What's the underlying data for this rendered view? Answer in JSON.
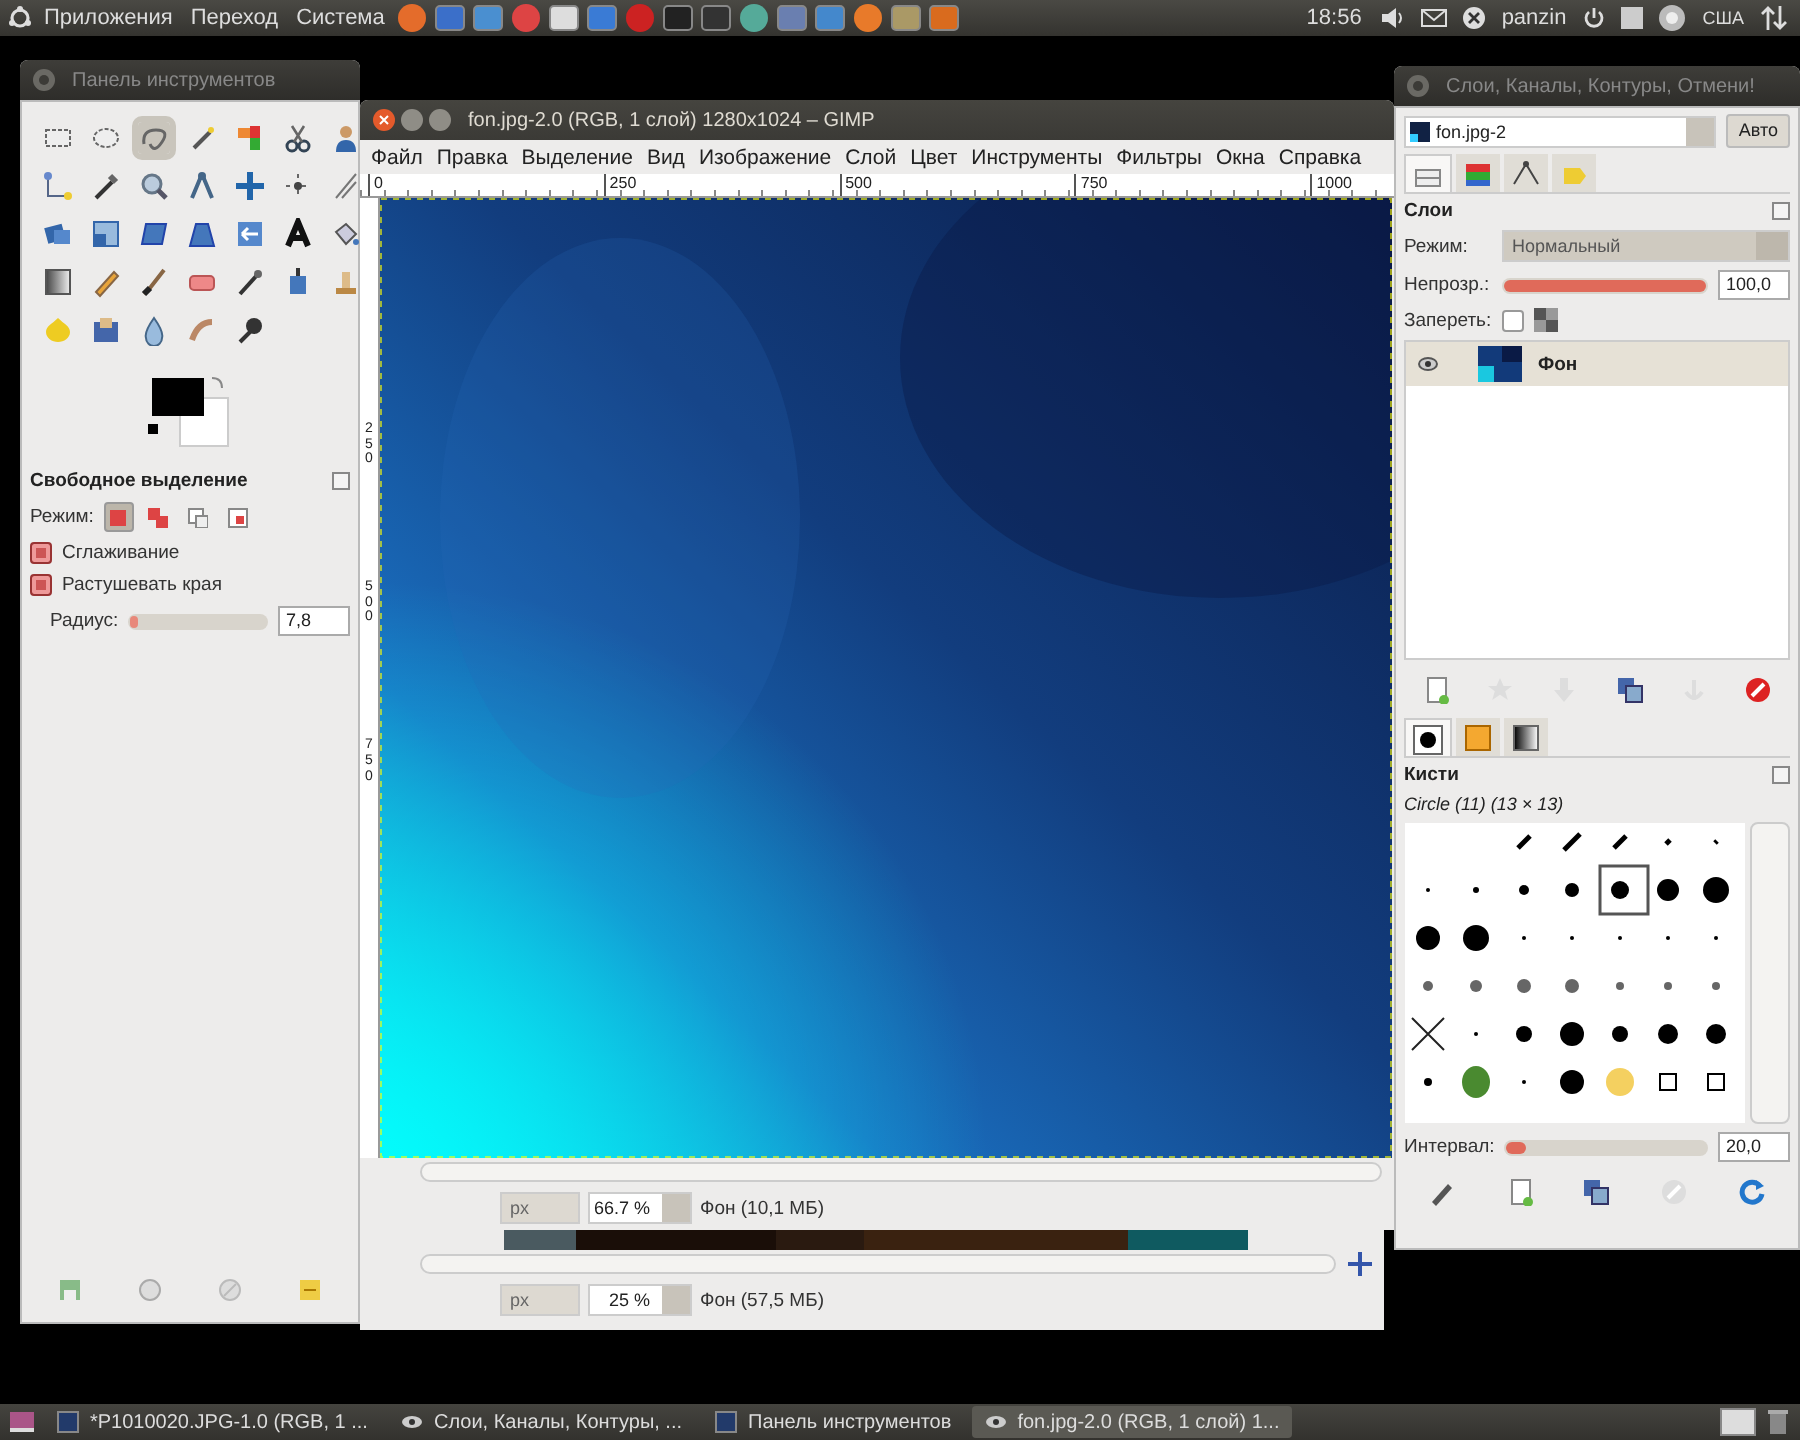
{
  "top_panel": {
    "menus": [
      "Приложения",
      "Переход",
      "Система"
    ],
    "time": "18:56",
    "user": "panzin",
    "keyboard": "США"
  },
  "toolbox": {
    "title": "Панель инструментов",
    "tools": [
      {
        "selected": false
      },
      {
        "selected": false
      },
      {
        "selected": true
      },
      {
        "selected": false
      },
      {
        "selected": false
      },
      {
        "selected": false
      },
      {
        "selected": false
      },
      {
        "selected": false
      },
      {
        "selected": false
      },
      {
        "selected": false
      },
      {
        "selected": false
      },
      {
        "selected": false
      },
      {
        "selected": false
      },
      {
        "selected": false
      },
      {
        "selected": false
      },
      {
        "selected": false
      },
      {
        "selected": false
      },
      {
        "selected": false
      },
      {
        "selected": false
      },
      {
        "selected": false
      },
      {
        "selected": false
      },
      {
        "selected": false
      },
      {
        "selected": false
      },
      {
        "selected": false
      },
      {
        "selected": false
      },
      {
        "selected": false
      },
      {
        "selected": false
      },
      {
        "selected": false
      },
      {
        "selected": false
      },
      {
        "selected": false
      },
      {
        "selected": false
      },
      {
        "selected": false
      },
      {
        "selected": false
      }
    ],
    "options": {
      "title": "Свободное выделение",
      "mode_label": "Режим:",
      "modes": [
        {
          "selected": true
        },
        {
          "selected": false
        },
        {
          "selected": false
        },
        {
          "selected": false
        }
      ],
      "checks": [
        {
          "label": "Сглаживание",
          "checked": true
        },
        {
          "label": "Растушевать края",
          "checked": true
        }
      ],
      "radius": {
        "label": "Радиус:",
        "value": "7,8",
        "level": 0.06
      }
    }
  },
  "image_window": {
    "title": "fon.jpg-2.0 (RGB, 1 слой) 1280x1024 – GIMP",
    "menus": [
      "Файл",
      "Правка",
      "Выделение",
      "Вид",
      "Изображение",
      "Слой",
      "Цвет",
      "Инструменты",
      "Фильтры",
      "Окна",
      "Справка"
    ],
    "ruler_ticks": [
      "0",
      "250",
      "500",
      "750",
      "1000"
    ],
    "vertical_ruler_ticks": [
      "250",
      "500",
      "750"
    ],
    "status": {
      "unit": "px",
      "zoom": "66.7 %",
      "info": "Фон (10,1 МБ)"
    }
  },
  "back_window": {
    "status": {
      "unit": "px",
      "zoom": "25 %",
      "info": "Фон (57,5 МБ)"
    }
  },
  "dock": {
    "title": "Слои, Каналы, Контуры, Отмени!",
    "image": "fon.jpg-2",
    "auto_button": "Авто",
    "tabs": [
      {
        "selected": true
      },
      {
        "selected": false
      },
      {
        "selected": false
      },
      {
        "selected": false
      }
    ],
    "layers": {
      "title": "Слои",
      "mode_label": "Режим:",
      "mode": "Нормальный",
      "opacity_label": "Непрозр.:",
      "opacity": {
        "value": "100,0",
        "level": 1.0
      },
      "lock_label": "Запереть:",
      "lock_checked": false,
      "items": [
        {
          "name": "Фон",
          "visible": true,
          "selected": true
        }
      ]
    },
    "brush_tabs": [
      {
        "selected": true
      },
      {
        "selected": false
      },
      {
        "selected": false
      }
    ],
    "brushes": {
      "title": "Кисти",
      "current": "Circle (11) (13 × 13)",
      "spacing_label": "Интервал:",
      "spacing": {
        "value": "20,0",
        "level": 0.1
      }
    }
  },
  "taskbar": {
    "items": [
      {
        "label": "*P1010020.JPG-1.0 (RGB, 1 ...",
        "selected": false
      },
      {
        "label": "Слои, Каналы, Контуры, ...",
        "selected": false
      },
      {
        "label": "Панель инструментов",
        "selected": false
      },
      {
        "label": "fon.jpg-2.0 (RGB, 1 слой) 1...",
        "selected": true
      }
    ]
  }
}
